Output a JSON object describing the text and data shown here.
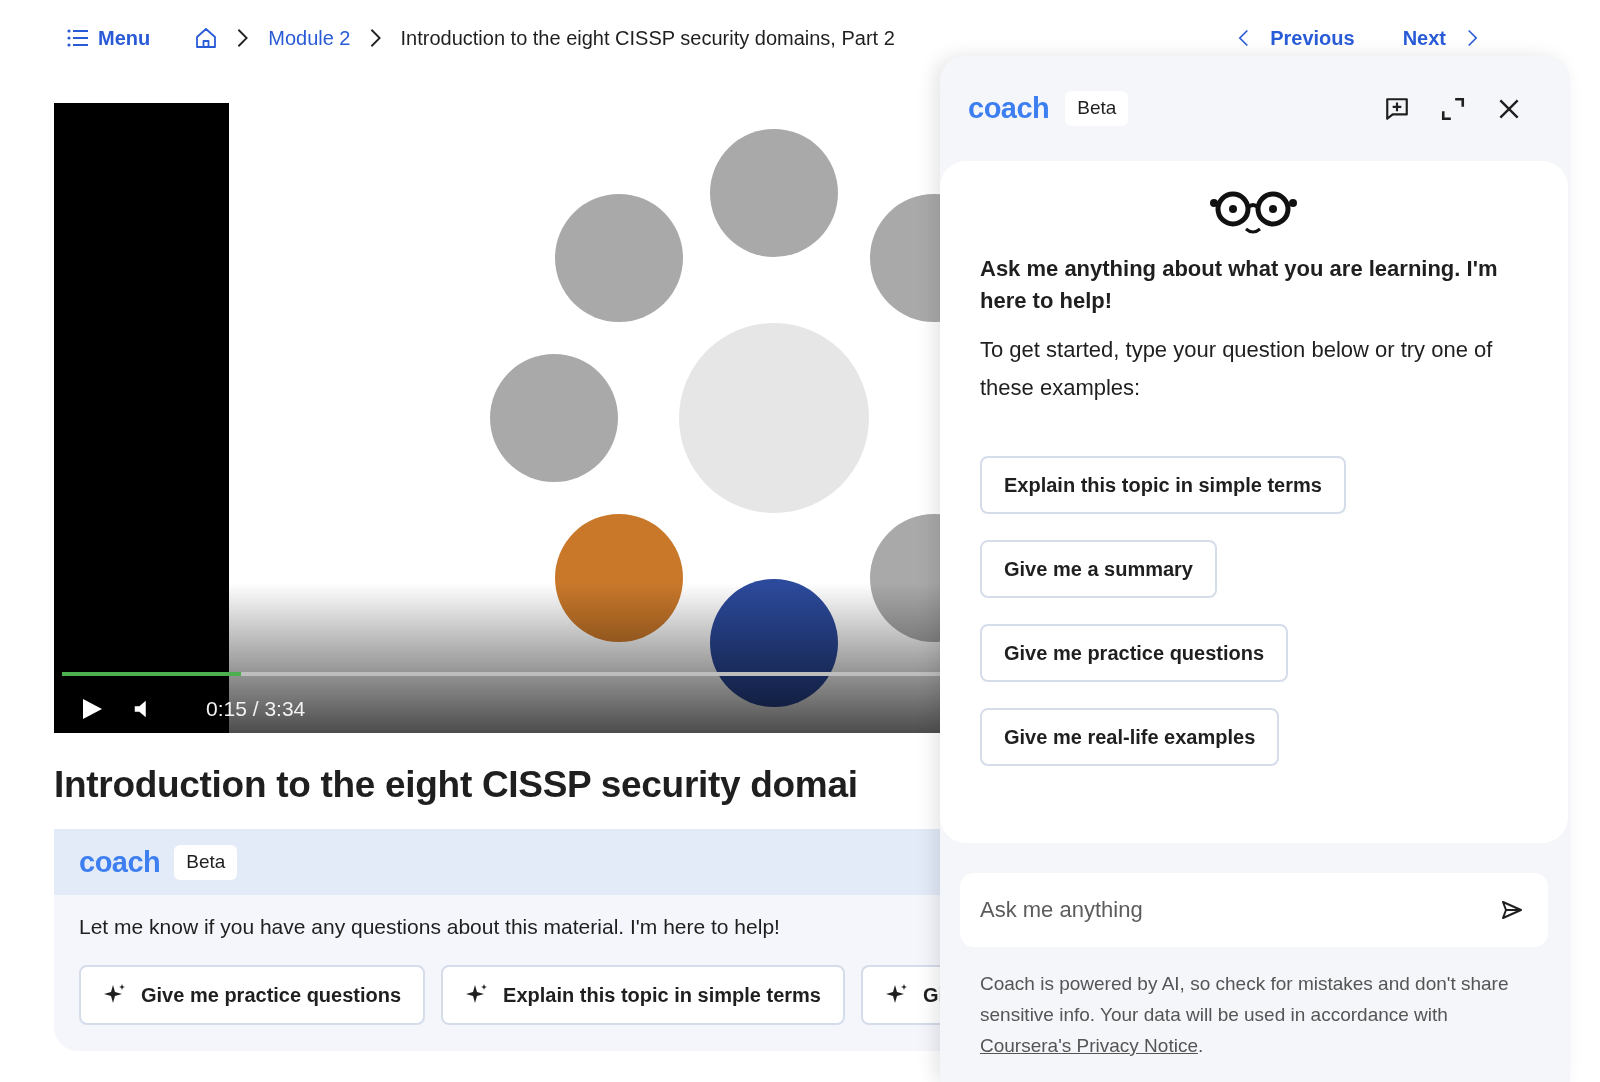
{
  "topbar": {
    "menu": "Menu",
    "breadcrumbs": [
      {
        "label": "Module 2",
        "kind": "link"
      },
      {
        "label": "Introduction to the eight CISSP security domains, Part 2",
        "kind": "current"
      }
    ],
    "previous": "Previous",
    "next": "Next"
  },
  "video": {
    "kind": "picture",
    "time": "0:15 / 3:34",
    "level": 0.12
  },
  "lesson_title": "Introduction to the eight CISSP security domai",
  "coach_card": {
    "logo": "coach",
    "badge": "Beta",
    "message": "Let me know if you have any questions about this material. I'm here to help!",
    "suggestions": [
      "Give me practice questions",
      "Explain this topic in simple terms",
      "Gi"
    ]
  },
  "coach_panel": {
    "logo": "coach",
    "badge": "Beta",
    "greeting": "Ask me anything about what you are learning. I'm here to help!",
    "intro": "To get started, type your question below or try one of these examples:",
    "suggestions": [
      "Explain this topic in simple terms",
      "Give me a summary",
      "Give me practice questions",
      "Give me real-life examples"
    ],
    "input": {
      "placeholder": "Ask me anything"
    },
    "disclaimer": "Coach is powered by AI, so check for mistakes and don't share sensitive info. Your data will be used in accordance with ",
    "disclaimer_link": "Coursera's Privacy Notice",
    "disclaimer_end": "."
  }
}
